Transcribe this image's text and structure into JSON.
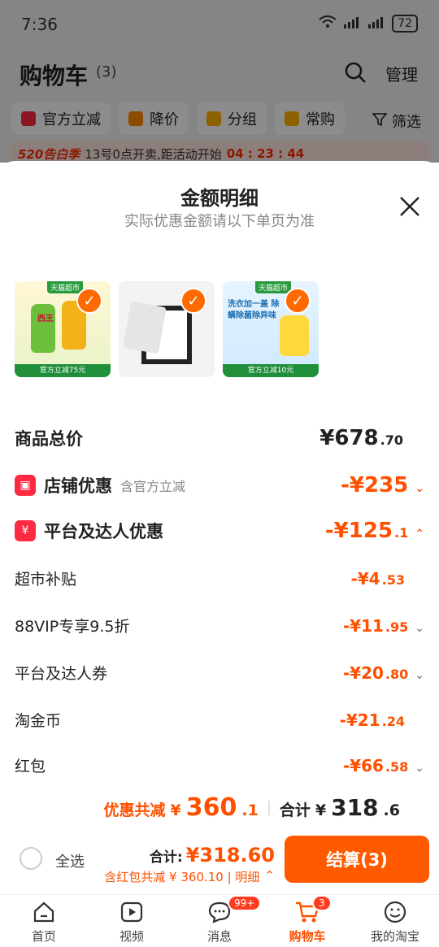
{
  "status": {
    "time": "7:36",
    "battery": "72",
    "signal_label": "6"
  },
  "header": {
    "title": "购物车",
    "count": "(3)",
    "manage": "管理"
  },
  "chips": [
    {
      "label": "官方立减",
      "color": "#ff2b42"
    },
    {
      "label": "降价",
      "color": "#ff8a00"
    },
    {
      "label": "分组",
      "color": "#ffb300"
    },
    {
      "label": "常购",
      "color": "#ffb300"
    }
  ],
  "filter_label": "筛选",
  "promo": {
    "tag": "520告白季",
    "text": "13号0点开卖,距活动开始",
    "countdown": "04 : 23 : 44"
  },
  "sheet": {
    "title": "金额明细",
    "subtitle": "实际优惠金额请以下单页为准",
    "products": [
      {
        "badge": "天猫超市",
        "bottom_tag": "官方立减75元",
        "text": "西王"
      },
      {
        "badge": "",
        "bottom_tag": "",
        "text": ""
      },
      {
        "badge": "天猫超市",
        "bottom_tag": "官方立减10元",
        "text": "洗衣加一盖 除螨除菌除异味"
      }
    ],
    "total_price": {
      "label": "商品总价",
      "int": "¥678",
      "dec": ".70"
    },
    "store_discount": {
      "label": "店铺优惠",
      "note": "含官方立减",
      "int": "-¥235",
      "dec": ""
    },
    "platform_discount": {
      "label": "平台及达人优惠",
      "int": "-¥125",
      "dec": ".1"
    },
    "items": [
      {
        "label": "超市补贴",
        "int": "-¥4",
        "dec": ".53",
        "chevron": false
      },
      {
        "label": "88VIP专享9.5折",
        "int": "-¥11",
        "dec": ".95",
        "chevron": true
      },
      {
        "label": "平台及达人券",
        "int": "-¥20",
        "dec": ".80",
        "chevron": true
      },
      {
        "label": "淘金币",
        "int": "-¥21",
        "dec": ".24",
        "chevron": false
      },
      {
        "label": "红包",
        "int": "-¥66",
        "dec": ".58",
        "chevron": true
      }
    ],
    "summary": {
      "saving_label": "优惠共减",
      "saving_cur": "¥",
      "saving_int": "360",
      "saving_dec": ".1",
      "total_label": "合计",
      "total_cur": "¥",
      "total_int": "318",
      "total_dec": ".6"
    }
  },
  "checkout": {
    "select_all": "全选",
    "total_label": "合计:",
    "total_value": "¥318.60",
    "detail_text": "含红包共减 ¥ 360.10 | 明细",
    "pay_label": "结算(3)"
  },
  "tabs": [
    {
      "label": "首页",
      "icon": "home-icon"
    },
    {
      "label": "视频",
      "icon": "video-icon"
    },
    {
      "label": "消息",
      "icon": "message-icon",
      "badge": "99+"
    },
    {
      "label": "购物车",
      "icon": "cart-icon",
      "badge": "3",
      "active": true
    },
    {
      "label": "我的淘宝",
      "icon": "profile-icon"
    }
  ]
}
